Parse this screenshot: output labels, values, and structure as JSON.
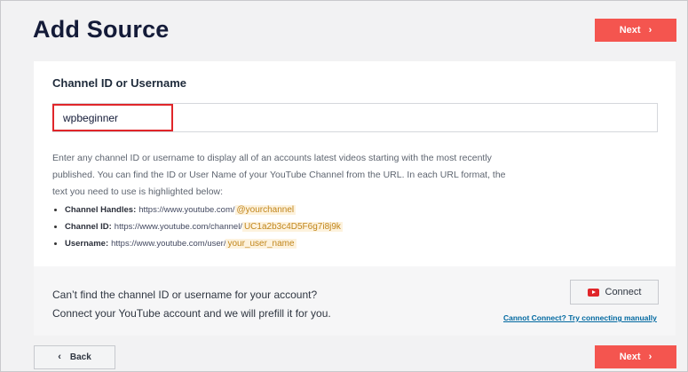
{
  "header": {
    "title": "Add Source",
    "next_label": "Next",
    "next_icon": "chevron-right-icon"
  },
  "card": {
    "section_title": "Channel ID or Username",
    "input_value": "wpbeginner",
    "description": "Enter any channel ID or username to display all of an accounts latest videos starting with the most recently published. You can find the ID or User Name of your YouTube Channel from the URL. In each URL format, the text you need to use is highlighted below:",
    "url_formats": [
      {
        "label": "Channel Handles:",
        "base": "https://www.youtube.com/",
        "highlight": "@yourchannel"
      },
      {
        "label": "Channel ID:",
        "base": "https://www.youtube.com/channel/",
        "highlight": "UC1a2b3c4D5F6g7i8j9k"
      },
      {
        "label": "Username:",
        "base": "https://www.youtube.com/user/",
        "highlight": "your_user_name"
      }
    ],
    "highlight_color": "#c1861c"
  },
  "connect": {
    "line1": "Can’t find the channel ID or username for your account?",
    "line2": "Connect your YouTube account and we will prefill it for you.",
    "button_label": "Connect",
    "button_icon": "youtube-icon",
    "manual_link": "Cannot Connect? Try connecting manually"
  },
  "footer": {
    "back_label": "Back",
    "back_icon": "chevron-left-icon",
    "next_label": "Next"
  },
  "colors": {
    "accent": "#f4554f",
    "title": "#141b38",
    "link": "#0068a0",
    "youtube": "#e0262a"
  }
}
